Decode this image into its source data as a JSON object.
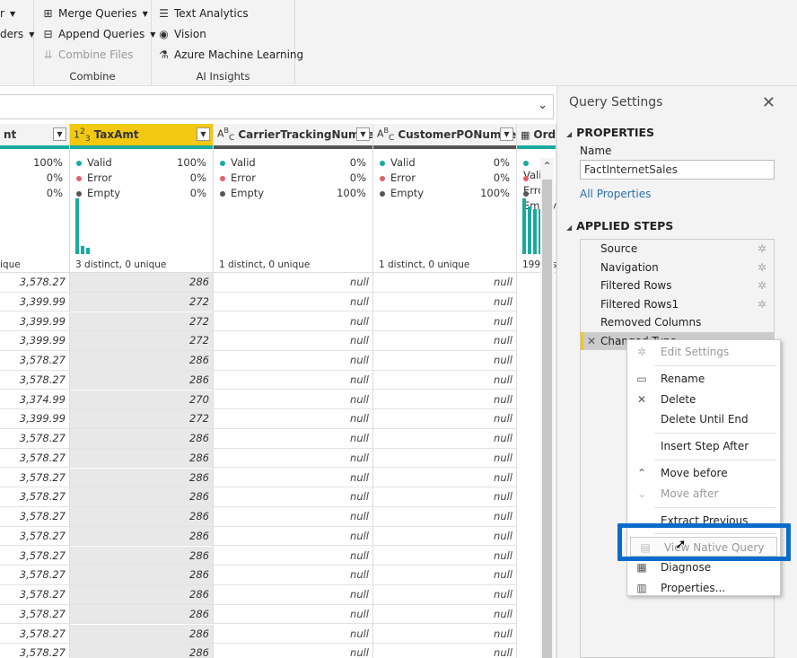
{
  "ribbon": {
    "partial_items": [
      {
        "label": "r",
        "caret": true
      },
      {
        "label": "ders",
        "caret": true
      }
    ],
    "combine": {
      "label": "Combine",
      "items": [
        {
          "label": "Merge Queries",
          "icon": "merge-queries-icon",
          "caret": true,
          "disabled": false
        },
        {
          "label": "Append Queries",
          "icon": "append-queries-icon",
          "caret": true,
          "disabled": false
        },
        {
          "label": "Combine Files",
          "icon": "combine-files-icon",
          "caret": false,
          "disabled": true
        }
      ]
    },
    "ai_insights": {
      "label": "AI Insights",
      "items": [
        {
          "label": "Text Analytics",
          "icon": "text-analytics-icon"
        },
        {
          "label": "Vision",
          "icon": "eye-icon"
        },
        {
          "label": "Azure Machine Learning",
          "icon": "flask-icon"
        }
      ]
    }
  },
  "formula_bar": {
    "value": "",
    "expand_icon": "chevron-down-icon"
  },
  "grid": {
    "columns": [
      {
        "name": "nt",
        "type_icon": "",
        "selected": false,
        "valid": "100%",
        "error": "0%",
        "empty": "0%",
        "distinct": "ique",
        "quality": "teal"
      },
      {
        "name": "TaxAmt",
        "type_icon": "1²₃",
        "selected": true,
        "valid": "100%",
        "error": "0%",
        "empty": "0%",
        "distinct": "3 distinct, 0 unique",
        "quality": "teal",
        "histogram": [
          1.0,
          0.15,
          0.12
        ]
      },
      {
        "name": "CarrierTrackingNumber",
        "type_icon": "AᴮC",
        "selected": false,
        "valid": "0%",
        "error": "0%",
        "empty": "100%",
        "distinct": "1 distinct, 0 unique",
        "quality": "dark"
      },
      {
        "name": "CustomerPONumber",
        "type_icon": "AᴮC",
        "selected": false,
        "valid": "0%",
        "error": "0%",
        "empty": "100%",
        "distinct": "1 distinct, 0 unique",
        "quality": "dark"
      },
      {
        "name": "Ord",
        "type_icon": "datetime",
        "selected": false,
        "valid": "",
        "error": "",
        "empty": "",
        "distinct": "199 dis",
        "quality": "teal",
        "histogram": [
          1.0,
          0.85,
          0.8,
          0.8,
          0.8
        ]
      }
    ],
    "labels": {
      "valid": "Valid",
      "error": "Error",
      "empty": "Empty"
    },
    "colors": {
      "valid": "#1aaa9f",
      "error": "#e15f6a",
      "empty": "#555555",
      "selected_header": "#f2c811"
    },
    "rows": [
      [
        "3,578.27",
        "286",
        "null",
        "null"
      ],
      [
        "3,399.99",
        "272",
        "null",
        "null"
      ],
      [
        "3,399.99",
        "272",
        "null",
        "null"
      ],
      [
        "3,399.99",
        "272",
        "null",
        "null"
      ],
      [
        "3,578.27",
        "286",
        "null",
        "null"
      ],
      [
        "3,578.27",
        "286",
        "null",
        "null"
      ],
      [
        "3,374.99",
        "270",
        "null",
        "null"
      ],
      [
        "3,399.99",
        "272",
        "null",
        "null"
      ],
      [
        "3,578.27",
        "286",
        "null",
        "null"
      ],
      [
        "3,578.27",
        "286",
        "null",
        "null"
      ],
      [
        "3,578.27",
        "286",
        "null",
        "null"
      ],
      [
        "3,578.27",
        "286",
        "null",
        "null"
      ],
      [
        "3,578.27",
        "286",
        "null",
        "null"
      ],
      [
        "3,578.27",
        "286",
        "null",
        "null"
      ],
      [
        "3,578.27",
        "286",
        "null",
        "null"
      ],
      [
        "3,578.27",
        "286",
        "null",
        "null"
      ],
      [
        "3,578.27",
        "286",
        "null",
        "null"
      ],
      [
        "3,578.27",
        "286",
        "null",
        "null"
      ],
      [
        "3,578.27",
        "286",
        "null",
        "null"
      ],
      [
        "3,578.27",
        "286",
        "null",
        "null"
      ]
    ]
  },
  "query_settings": {
    "title": "Query Settings",
    "properties_label": "PROPERTIES",
    "name_label": "Name",
    "name_value": "FactInternetSales",
    "all_properties": "All Properties",
    "applied_steps_label": "APPLIED STEPS",
    "steps": [
      {
        "label": "Source",
        "gear": true
      },
      {
        "label": "Navigation",
        "gear": true
      },
      {
        "label": "Filtered Rows",
        "gear": true
      },
      {
        "label": "Filtered Rows1",
        "gear": true
      },
      {
        "label": "Removed Columns",
        "gear": false
      },
      {
        "label": "Changed Type",
        "gear": false,
        "active": true
      }
    ]
  },
  "context_menu": {
    "items": [
      {
        "label": "Edit Settings",
        "icon": "gear-icon",
        "disabled": true
      },
      {
        "sep": true
      },
      {
        "label": "Rename",
        "icon": "rename-icon",
        "disabled": false
      },
      {
        "label": "Delete",
        "icon": "delete-icon",
        "disabled": false
      },
      {
        "label": "Delete Until End",
        "icon": "",
        "disabled": false
      },
      {
        "sep": true
      },
      {
        "label": "Insert Step After",
        "icon": "",
        "disabled": false
      },
      {
        "sep": true
      },
      {
        "label": "Move before",
        "icon": "chevron-up-icon",
        "disabled": false
      },
      {
        "label": "Move after",
        "icon": "chevron-down-icon",
        "disabled": true
      },
      {
        "sep": true
      },
      {
        "label": "Extract Previous",
        "icon": "",
        "disabled": false
      },
      {
        "sep": true
      },
      {
        "label": "View Native Query",
        "icon": "native-query-icon",
        "disabled": true,
        "hover": true
      },
      {
        "label": "Diagnose",
        "icon": "diagnose-icon",
        "disabled": false
      },
      {
        "label": "Properties...",
        "icon": "properties-icon",
        "disabled": false
      }
    ],
    "highlight_color": "#0b6bcb"
  }
}
